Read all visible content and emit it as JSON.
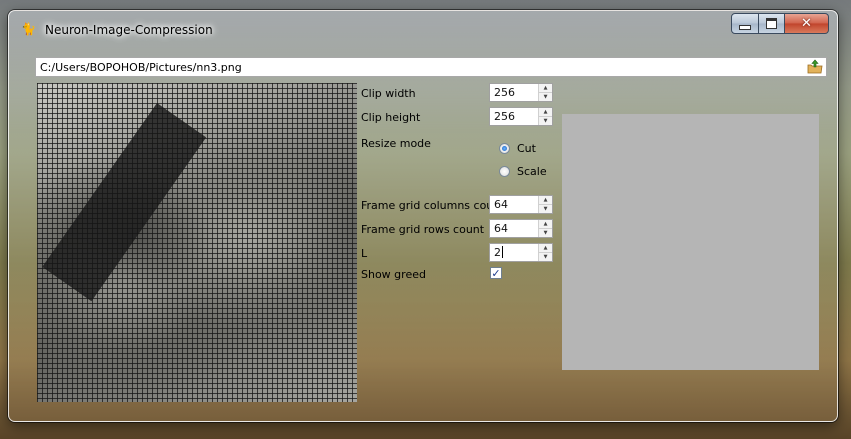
{
  "window": {
    "title": "Neuron-Image-Compression",
    "app_icon": "cat-icon"
  },
  "path": {
    "value": "C:/Users/BOPOHOB/Pictures/nn3.png",
    "open_icon": "open-folder-icon"
  },
  "controls": {
    "clip_width": {
      "label": "Clip width",
      "value": "256"
    },
    "clip_height": {
      "label": "Clip height",
      "value": "256"
    },
    "resize_mode": {
      "label": "Resize mode",
      "options": [
        {
          "label": "Cut",
          "checked": true
        },
        {
          "label": "Scale",
          "checked": false
        }
      ]
    },
    "grid_columns": {
      "label": "Frame grid columns count",
      "value": "64"
    },
    "grid_rows": {
      "label": "Frame grid rows count",
      "value": "64"
    },
    "l": {
      "label": "L",
      "value": "2"
    },
    "show_greed": {
      "label": "Show greed",
      "checked": true
    }
  },
  "colors": {
    "output_background": "#b5b5b5",
    "close_button": "#c0432b"
  }
}
